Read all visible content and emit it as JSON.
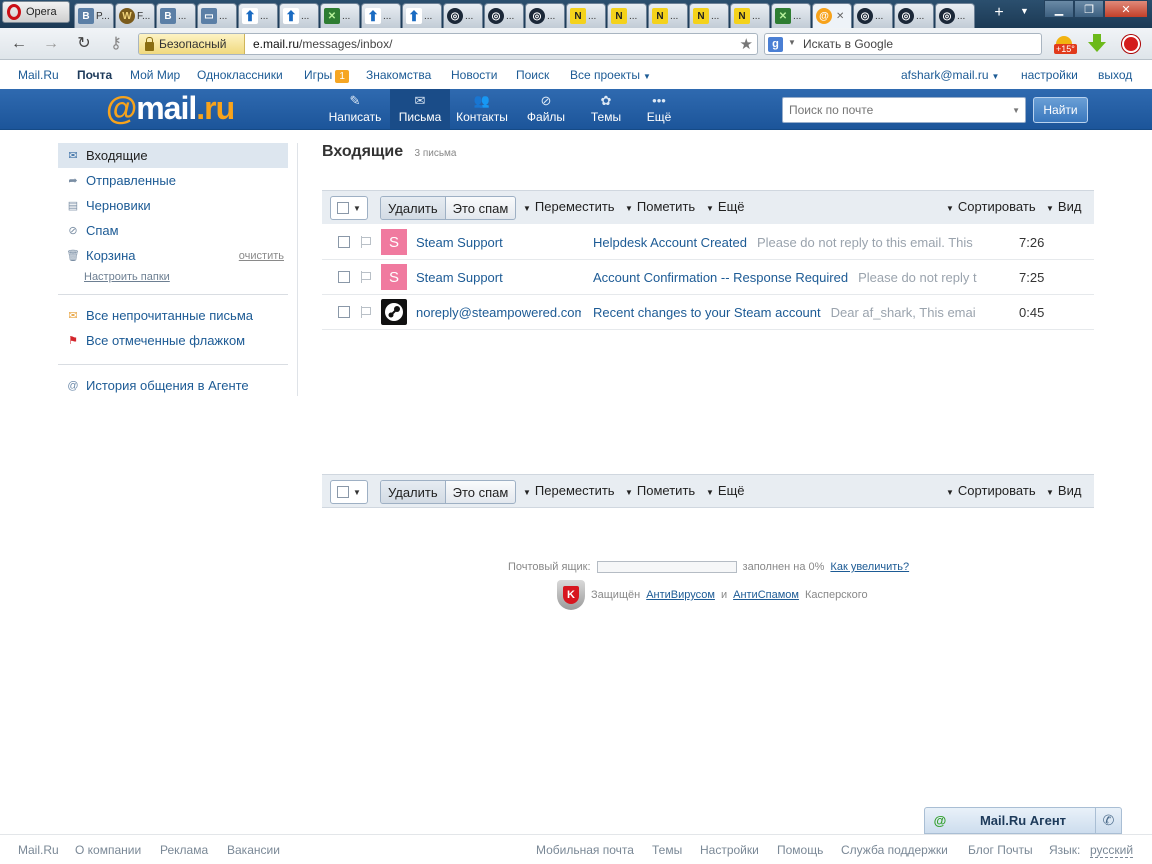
{
  "browser": {
    "opera_label": "Opera",
    "tabs": [
      {
        "icon": "vk-icon",
        "label": "P..."
      },
      {
        "icon": "wow-icon",
        "label": "F..."
      },
      {
        "icon": "vk-icon",
        "label": "..."
      },
      {
        "icon": "chat-icon",
        "label": "..."
      },
      {
        "icon": "upload-arrow-icon",
        "label": "..."
      },
      {
        "icon": "upload-arrow-icon",
        "label": "..."
      },
      {
        "icon": "green-game-icon",
        "label": "..."
      },
      {
        "icon": "upload-arrow-icon",
        "label": "..."
      },
      {
        "icon": "upload-arrow-icon",
        "label": "..."
      },
      {
        "icon": "steam-icon",
        "label": "..."
      },
      {
        "icon": "steam-icon",
        "label": "..."
      },
      {
        "icon": "steam-icon",
        "label": "..."
      },
      {
        "icon": "n-icon",
        "label": "..."
      },
      {
        "icon": "n-icon",
        "label": "..."
      },
      {
        "icon": "n-icon",
        "label": "..."
      },
      {
        "icon": "n-icon",
        "label": "..."
      },
      {
        "icon": "n-icon",
        "label": "..."
      },
      {
        "icon": "green-game-icon",
        "label": "..."
      },
      {
        "icon": "mail-at-icon",
        "label": "",
        "active": true
      },
      {
        "icon": "steam-icon",
        "label": "..."
      },
      {
        "icon": "steam-icon",
        "label": "..."
      },
      {
        "icon": "steam-icon",
        "label": "..."
      }
    ],
    "security_badge": "Безопасный",
    "url_host": "e.mail.ru",
    "url_path": "/messages/inbox/",
    "search_placeholder": "Искать в Google",
    "weather_temp": "+15°"
  },
  "topnav": {
    "mailru": "Mail.Ru",
    "pochta": "Почта",
    "moymir": "Мой Мир",
    "odnoklassniki": "Одноклассники",
    "igry": "Игры",
    "igry_badge": "1",
    "znakomstva": "Знакомства",
    "novosti": "Новости",
    "poisk": "Поиск",
    "vse_proekty": "Все проекты",
    "user_email": "afshark@mail.ru",
    "settings": "настройки",
    "logout": "выход"
  },
  "header": {
    "logo_at": "@",
    "logo_mail": "mail",
    "logo_dot": ".",
    "logo_ru": "ru",
    "nav": {
      "compose": "Написать",
      "letters": "Письма",
      "contacts": "Контакты",
      "files": "Файлы",
      "themes": "Темы",
      "more": "Ещё"
    },
    "search_placeholder": "Поиск по почте",
    "find_button": "Найти"
  },
  "sidebar": {
    "inbox": "Входящие",
    "sent": "Отправленные",
    "drafts": "Черновики",
    "spam": "Спам",
    "trash": "Корзина",
    "trash_clear": "очистить",
    "setup_folders": "Настроить папки",
    "all_unread": "Все непрочитанные письма",
    "all_flagged": "Все отмеченные флажком",
    "agent_history": "История общения в Агенте"
  },
  "main": {
    "folder_title": "Входящие",
    "folder_count": "3 письма",
    "toolbar": {
      "delete": "Удалить",
      "spam": "Это спам",
      "move": "Переместить",
      "mark": "Пометить",
      "more": "Ещё",
      "sort": "Сортировать",
      "view": "Вид"
    },
    "messages": [
      {
        "avatar": "S",
        "from": "Steam Support",
        "subject": "Helpdesk Account Created",
        "preview": "Please do not reply to this email. This",
        "time": "7:26"
      },
      {
        "avatar": "S",
        "from": "Steam Support",
        "subject": "Account Confirmation -- Response Required",
        "preview": "Please do not reply t",
        "time": "7:25"
      },
      {
        "avatar": "",
        "from": "noreply@steampowered.com",
        "subject": "Recent changes to your Steam account",
        "preview": "Dear af_shark, This emai",
        "time": "0:45"
      }
    ]
  },
  "quota": {
    "label": "Почтовый ящик:",
    "filled": "заполнен на 0%",
    "percent": 0,
    "increase_link": "Как увеличить?"
  },
  "antivirus": {
    "prefix": "Защищён",
    "antivirus": "АнтиВирусом",
    "and": "и",
    "antispam": "АнтиСпамом",
    "suffix": "Касперского"
  },
  "agent": {
    "label": "Mail.Ru Агент"
  },
  "footer": {
    "mailru": "Mail.Ru",
    "about": "О компании",
    "ads": "Реклама",
    "jobs": "Вакансии",
    "mobile": "Мобильная почта",
    "themes": "Темы",
    "settings": "Настройки",
    "help": "Помощь",
    "support": "Служба поддержки",
    "blog": "Блог Почты",
    "lang_label": "Язык:",
    "lang_value": "русский"
  }
}
